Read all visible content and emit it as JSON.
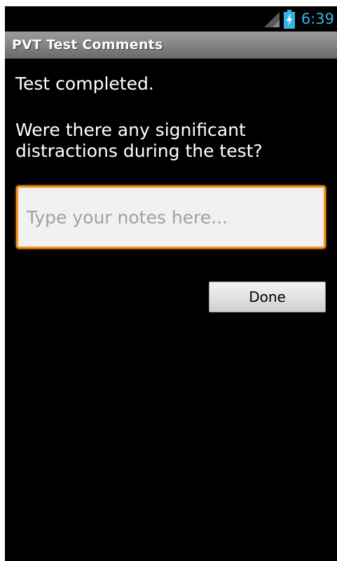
{
  "status_bar": {
    "time": "6:39",
    "signal_icon": "signal-icon",
    "battery_icon": "battery-charging-icon",
    "accent_color": "#33b5e5"
  },
  "title_bar": {
    "title": "PVT Test Comments"
  },
  "content": {
    "completed_text": "Test completed.",
    "question_text": "Were there any significant distractions during the test?",
    "notes_input": {
      "value": "",
      "placeholder": "Type your notes here..."
    },
    "done_label": "Done"
  },
  "colors": {
    "background": "#000000",
    "input_focus_border": "#f7941d"
  }
}
